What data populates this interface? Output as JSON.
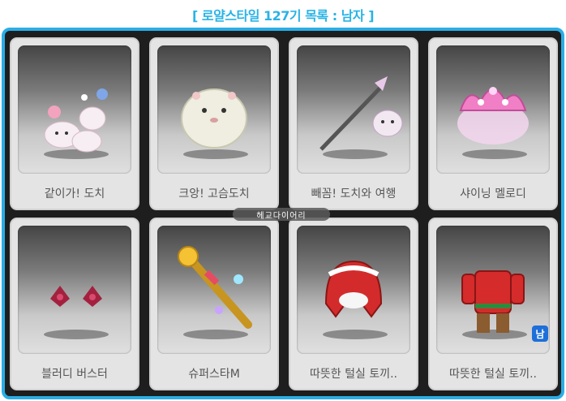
{
  "header": {
    "title": "[ 로얄스타일 127기 목록 : 남자 ]"
  },
  "colors": {
    "accent": "#2aaee6",
    "frame": "#1e1e1e",
    "badge": "#1e6fd9"
  },
  "items": [
    {
      "label": "같이가! 도치",
      "icon": "hedgehog-family-icon"
    },
    {
      "label": "크앙! 고슴도치",
      "icon": "white-hedgehog-icon"
    },
    {
      "label": "빼꼼! 도치와 여행",
      "icon": "hedgehog-bindle-weapon-icon"
    },
    {
      "label": "샤이닝 멜로디",
      "icon": "pink-crown-icon"
    },
    {
      "label": "블러디 버스터",
      "icon": "red-flower-effect-icon"
    },
    {
      "label": "슈퍼스타M",
      "icon": "golden-microphone-weapon-icon"
    },
    {
      "label": "따뜻한 털실 토끼..",
      "icon": "red-knit-hat-icon"
    },
    {
      "label": "따뜻한 털실 토끼..",
      "icon": "red-knit-outfit-icon",
      "badge": "남"
    }
  ],
  "watermark": "헤교다이어리"
}
